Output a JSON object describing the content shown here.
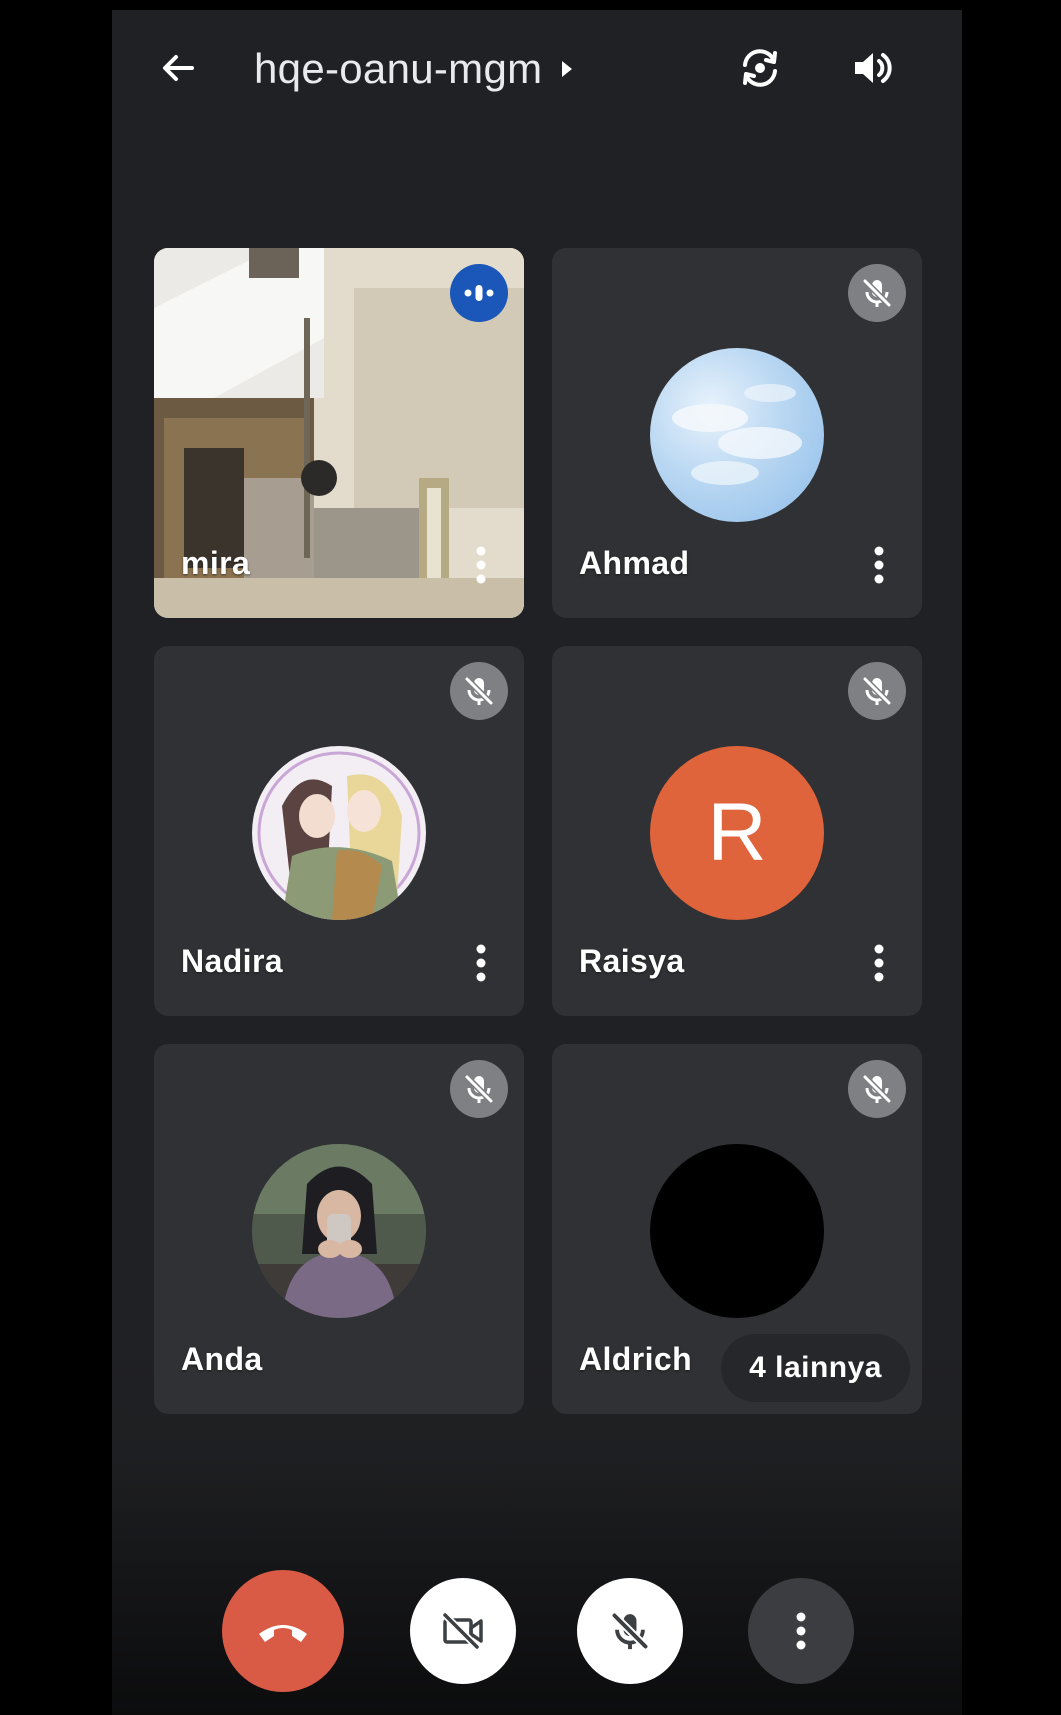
{
  "topbar": {
    "meeting_code": "hqe-oanu-mgm",
    "back_icon": "arrow-left-icon",
    "caret_icon": "caret-right-icon",
    "switch_camera_icon": "switch-camera-icon",
    "speaker_icon": "speaker-icon"
  },
  "participants": [
    {
      "name": "mira",
      "state": "speaking",
      "video_on": true
    },
    {
      "name": "Ahmad",
      "state": "muted",
      "avatar": "sky-photo"
    },
    {
      "name": "Nadira",
      "state": "muted",
      "avatar": "anime-illustration"
    },
    {
      "name": "Raisya",
      "state": "muted",
      "avatar_initial": "R",
      "avatar_color": "#e0643b"
    },
    {
      "name": "Anda",
      "state": "muted",
      "avatar": "user-photo"
    },
    {
      "name": "Aldrich",
      "state": "muted",
      "avatar": "black"
    }
  ],
  "more_participants_label": "4 lainnya",
  "controls": {
    "end_call_icon": "end-call-icon",
    "camera_icon": "camera-off-icon",
    "mic_icon": "mic-off-icon",
    "more_icon": "more-vertical-icon"
  },
  "colors": {
    "background": "#202124",
    "tile": "#303134",
    "end_call": "#d95a45",
    "speaking_badge": "#1a57b8",
    "mute_badge": "#7f8083"
  }
}
